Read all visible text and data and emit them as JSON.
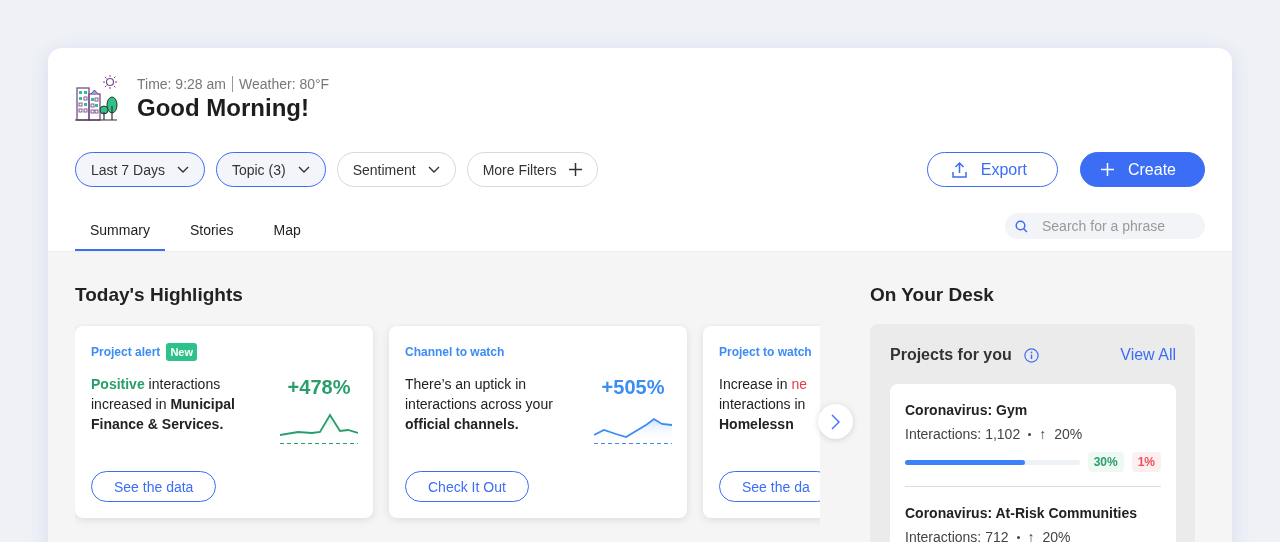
{
  "header": {
    "time": "Time: 9:28 am",
    "weather": "Weather: 80°F",
    "greeting": "Good Morning!"
  },
  "filters": [
    {
      "label": "Last 7 Days",
      "kind": "dropdown",
      "active": true
    },
    {
      "label": "Topic (3)",
      "kind": "dropdown",
      "active": true
    },
    {
      "label": "Sentiment",
      "kind": "dropdown",
      "active": false
    },
    {
      "label": "More Filters",
      "kind": "add",
      "active": false
    }
  ],
  "actions": [
    {
      "label": "Export",
      "kind": "secondary"
    },
    {
      "label": "Create",
      "kind": "primary"
    }
  ],
  "tabs": [
    {
      "label": "Summary",
      "selected": true
    },
    {
      "label": "Stories",
      "selected": false
    },
    {
      "label": "Map",
      "selected": false
    }
  ],
  "search": {
    "placeholder": "Search for a phrase"
  },
  "highlights": {
    "title": "Today's Highlights",
    "cards": [
      {
        "category": "Project alert",
        "badge": "New",
        "lines": [
          [
            {
              "text": "Positive",
              "kind": "positive"
            },
            {
              "text": " interactions",
              "kind": "plain"
            }
          ],
          [
            {
              "text": "increased in ",
              "kind": "plain"
            },
            {
              "text": "Municipal",
              "kind": "bold"
            }
          ],
          [
            {
              "text": "Finance & Services.",
              "kind": "bold"
            }
          ]
        ],
        "change": "+478%",
        "kind": "positive",
        "button": "See the data"
      },
      {
        "category": "Channel to watch",
        "lines": [
          [
            {
              "text": "There’s an uptick in",
              "kind": "plain"
            }
          ],
          [
            {
              "text": "interactions across your",
              "kind": "plain"
            }
          ],
          [
            {
              "text": "official channels.",
              "kind": "bold"
            }
          ]
        ],
        "change": "+505%",
        "kind": "neutral",
        "button": "Check It Out"
      },
      {
        "category": "Project to watch",
        "lines": [
          [
            {
              "text": "Increase in ",
              "kind": "plain"
            },
            {
              "text": "ne",
              "kind": "negative"
            }
          ],
          [
            {
              "text": "interactions in",
              "kind": "plain"
            }
          ],
          [
            {
              "text": "Homelessn",
              "kind": "bold"
            }
          ]
        ],
        "button": "See the da"
      }
    ]
  },
  "desk": {
    "title": "On Your Desk",
    "panel_title": "Projects for you",
    "link": "View All",
    "projects": [
      {
        "name": "Coronavirus: Gym",
        "interactions": "Interactions: 1,102",
        "trend": "↑",
        "trend_value": "20%",
        "level": 0.69,
        "positive": "30%",
        "negative": "1%"
      },
      {
        "name": "Coronavirus: At-Risk Communities",
        "interactions": "Interactions: 712",
        "trend": "↑",
        "trend_value": "20%"
      }
    ]
  }
}
